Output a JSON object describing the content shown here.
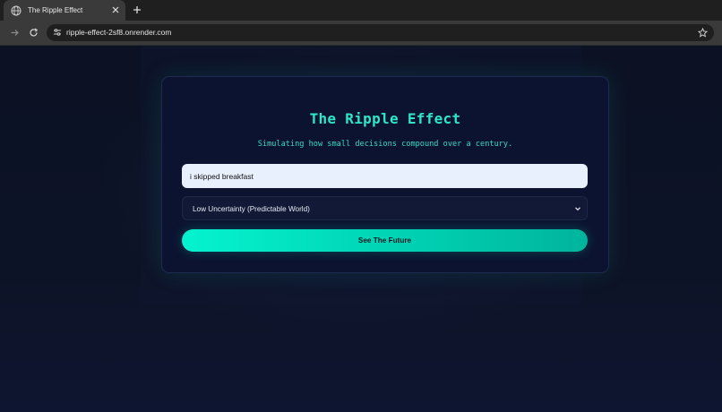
{
  "browser": {
    "tab_title": "The Ripple Effect",
    "url": "ripple-effect-2sf8.onrender.com",
    "icons": {
      "favicon": "globe-icon",
      "close": "close-icon",
      "new_tab": "plus-icon",
      "forward": "arrow-right-icon",
      "reload": "reload-icon",
      "site_info": "tune-icon",
      "bookmark": "star-icon"
    }
  },
  "app": {
    "title": "The Ripple Effect",
    "subtitle": "Simulating how small decisions compound over a century.",
    "decision_input": {
      "value": "i skipped breakfast"
    },
    "uncertainty_select": {
      "selected": "Low Uncertainty (Predictable World)",
      "icon": "chevron-down-icon"
    },
    "submit_label": "See The Future"
  },
  "colors": {
    "accent": "#2ee6c8",
    "button_gradient_start": "#05f3cf",
    "button_gradient_end": "#00b49c",
    "card_background": "#0c1330",
    "page_background": "#0c1120"
  }
}
